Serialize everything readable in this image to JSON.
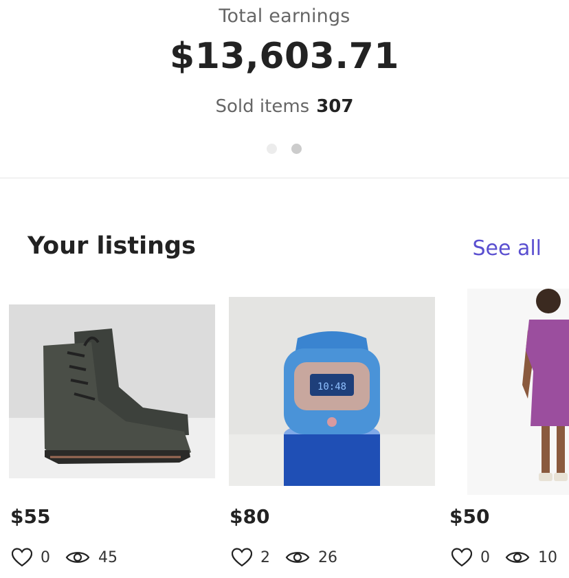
{
  "earnings": {
    "label": "Total earnings",
    "value": "$13,603.71",
    "sold_label": "Sold items",
    "sold_count": "307",
    "pager": {
      "pages": 2,
      "active_index": 1
    }
  },
  "listings": {
    "title": "Your listings",
    "see_all": "See all",
    "items": [
      {
        "price": "$55",
        "likes": "0",
        "views": "45"
      },
      {
        "price": "$80",
        "likes": "2",
        "views": "26"
      },
      {
        "price": "$50",
        "likes": "0",
        "views": "10"
      }
    ]
  },
  "colors": {
    "accent": "#5a4fd0",
    "text": "#222222",
    "muted": "#666666"
  }
}
